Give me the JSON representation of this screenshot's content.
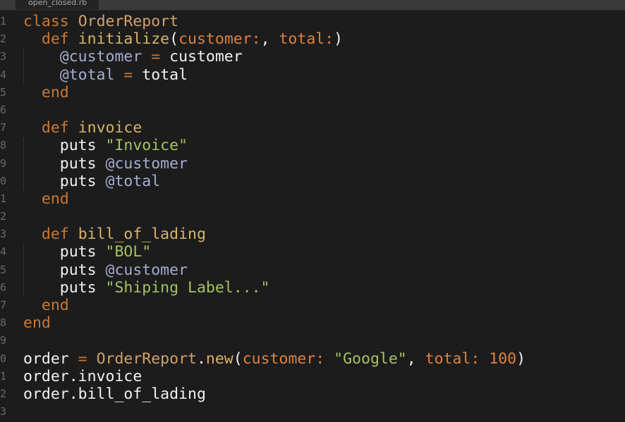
{
  "tab": {
    "label": "open_closed.rb"
  },
  "gutter": [
    "1",
    "2",
    "3",
    "4",
    "5",
    "6",
    "7",
    "8",
    "9",
    "0",
    "1",
    "2",
    "3",
    "4",
    "5",
    "6",
    "7",
    "8",
    "9",
    "0",
    "1",
    "2",
    "3"
  ],
  "colors": {
    "background": "#1c1c1c",
    "keyword": "#cc7833",
    "class_name": "#d2a06b",
    "method_name": "#dab266",
    "symbol": "#e1803c",
    "instance_variable": "#a6acd0",
    "string": "#a5c261",
    "number": "#e1803c",
    "text": "#f2f2f2"
  },
  "lines": [
    [
      [
        "kw",
        "class"
      ],
      [
        "plain",
        " "
      ],
      [
        "cls",
        "OrderReport"
      ]
    ],
    [
      [
        "plain",
        "  "
      ],
      [
        "kw",
        "def"
      ],
      [
        "plain",
        " "
      ],
      [
        "fn",
        "initialize"
      ],
      [
        "plain",
        "("
      ],
      [
        "sym",
        "customer:"
      ],
      [
        "plain",
        ", "
      ],
      [
        "sym",
        "total:"
      ],
      [
        "plain",
        ")"
      ]
    ],
    [
      [
        "plain",
        "    "
      ],
      [
        "ivar",
        "@customer"
      ],
      [
        "plain",
        " "
      ],
      [
        "op",
        "="
      ],
      [
        "plain",
        " customer"
      ]
    ],
    [
      [
        "plain",
        "    "
      ],
      [
        "ivar",
        "@total"
      ],
      [
        "plain",
        " "
      ],
      [
        "op",
        "="
      ],
      [
        "plain",
        " total"
      ]
    ],
    [
      [
        "plain",
        "  "
      ],
      [
        "kw",
        "end"
      ]
    ],
    [],
    [
      [
        "plain",
        "  "
      ],
      [
        "kw",
        "def"
      ],
      [
        "plain",
        " "
      ],
      [
        "fn",
        "invoice"
      ]
    ],
    [
      [
        "plain",
        "    puts "
      ],
      [
        "str",
        "\"Invoice\""
      ]
    ],
    [
      [
        "plain",
        "    puts "
      ],
      [
        "ivar",
        "@customer"
      ]
    ],
    [
      [
        "plain",
        "    puts "
      ],
      [
        "ivar",
        "@total"
      ]
    ],
    [
      [
        "plain",
        "  "
      ],
      [
        "kw",
        "end"
      ]
    ],
    [],
    [
      [
        "plain",
        "  "
      ],
      [
        "kw",
        "def"
      ],
      [
        "plain",
        " "
      ],
      [
        "fn",
        "bill_of_lading"
      ]
    ],
    [
      [
        "plain",
        "    puts "
      ],
      [
        "str",
        "\"BOL\""
      ]
    ],
    [
      [
        "plain",
        "    puts "
      ],
      [
        "ivar",
        "@customer"
      ]
    ],
    [
      [
        "plain",
        "    puts "
      ],
      [
        "str",
        "\"Shiping Label...\""
      ]
    ],
    [
      [
        "plain",
        "  "
      ],
      [
        "kw",
        "end"
      ]
    ],
    [
      [
        "kw",
        "end"
      ]
    ],
    [],
    [
      [
        "plain",
        "order "
      ],
      [
        "op",
        "="
      ],
      [
        "plain",
        " "
      ],
      [
        "cls",
        "OrderReport"
      ],
      [
        "plain",
        "."
      ],
      [
        "fn",
        "new"
      ],
      [
        "plain",
        "("
      ],
      [
        "sym",
        "customer:"
      ],
      [
        "plain",
        " "
      ],
      [
        "str",
        "\"Google\""
      ],
      [
        "plain",
        ", "
      ],
      [
        "sym",
        "total:"
      ],
      [
        "plain",
        " "
      ],
      [
        "num",
        "100"
      ],
      [
        "plain",
        ")"
      ]
    ],
    [
      [
        "plain",
        "order.invoice"
      ]
    ],
    [
      [
        "plain",
        "order.bill_of_lading"
      ]
    ],
    []
  ]
}
